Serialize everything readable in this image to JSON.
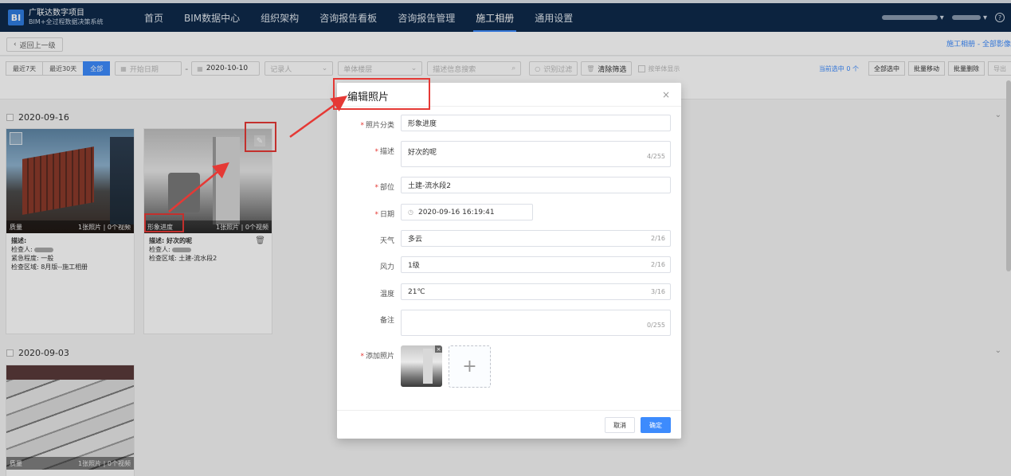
{
  "app": {
    "logo_badge": "BI",
    "title": "广联达数字项目",
    "subtitle": "BIM+全过程数据决策系统"
  },
  "nav": {
    "items": [
      {
        "label": "首页"
      },
      {
        "label": "BIM数据中心"
      },
      {
        "label": "组织架构"
      },
      {
        "label": "咨询报告看板"
      },
      {
        "label": "咨询报告管理"
      },
      {
        "label": "施工相册"
      },
      {
        "label": "通用设置"
      }
    ],
    "active_index": 5,
    "help": "?"
  },
  "subbar": {
    "back_label": "返回上一级",
    "crumb": "施工相册 - 全部影像"
  },
  "filters": {
    "range_buttons": [
      "最近7天",
      "最近30天",
      "全部"
    ],
    "active_range": "全部",
    "start_placeholder": "开始日期",
    "end_value": "2020-10-10",
    "recorder_placeholder": "记录人",
    "floor_placeholder": "单体楼层",
    "search_placeholder": "描述信息搜索",
    "status_filter_label": "识别过滤",
    "clear_label": "清除筛选",
    "by_unit_label": "按单体显示",
    "selected_count": "当前选中 0 个",
    "select_all": "全部选中",
    "batch_move": "批量移动",
    "batch_delete": "批量删除",
    "export": "导出"
  },
  "groups": [
    {
      "date": "2020-09-16",
      "cards": [
        {
          "tag": "质量",
          "meta": "1张照片 | 0个视频",
          "desc": "描述:",
          "inspector": "检查人:",
          "urgency": "紧急程度: 一般",
          "area": "检查区域: 8月版--施工相册"
        },
        {
          "tag": "形象进度",
          "meta": "1张照片 | 0个视频",
          "desc": "描述: 好次的呢",
          "inspector": "检查人:",
          "area": "检查区域: 土建-流水段2"
        }
      ]
    },
    {
      "date": "2020-09-03",
      "cards": [
        {
          "tag": "质量",
          "meta": "1张照片 | 0个视频"
        }
      ]
    }
  ],
  "modal": {
    "title": "编辑照片",
    "fields": {
      "category": {
        "label": "照片分类",
        "value": "形象进度"
      },
      "description": {
        "label": "描述",
        "value": "好次的呢",
        "count": "4/255"
      },
      "location": {
        "label": "部位",
        "value": "土建-流水段2"
      },
      "date": {
        "label": "日期",
        "value": "2020-09-16 16:19:41"
      },
      "weather": {
        "label": "天气",
        "value": "多云",
        "count": "2/16"
      },
      "wind": {
        "label": "风力",
        "value": "1级",
        "count": "2/16"
      },
      "temperature": {
        "label": "温度",
        "value": "21℃",
        "count": "3/16"
      },
      "remark": {
        "label": "备注",
        "value": "",
        "count": "0/255"
      },
      "photos": {
        "label": "添加照片",
        "add": "+"
      }
    },
    "cancel": "取消",
    "confirm": "确定"
  },
  "colors": {
    "nav_bg": "#0f2a4a",
    "accent": "#3d8bfd",
    "annotation": "#e53935"
  }
}
